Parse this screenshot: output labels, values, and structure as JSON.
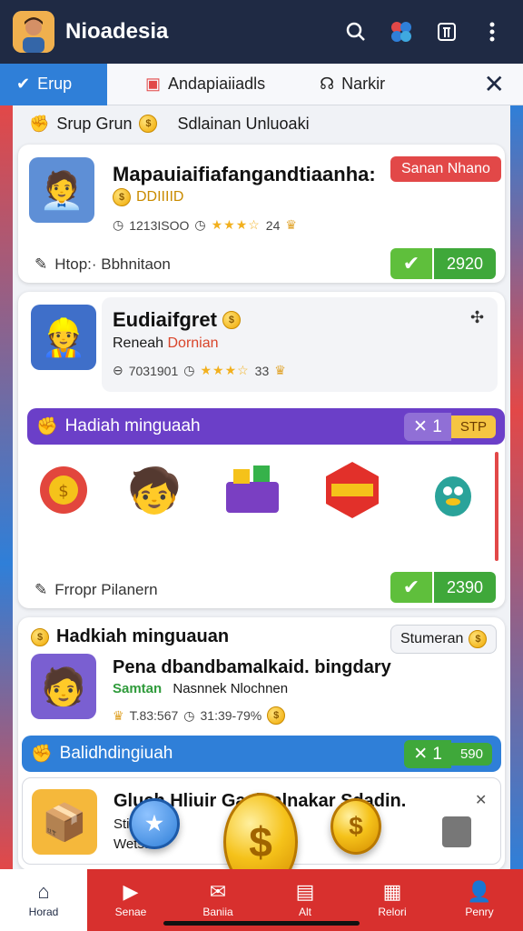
{
  "appbar": {
    "title": "Nioadesia"
  },
  "tabs": {
    "items": [
      {
        "label": "Erup"
      },
      {
        "label": "Andapiaiiadls"
      },
      {
        "label": "Narkir"
      }
    ]
  },
  "section1": {
    "label": "Srup Grun",
    "sub_label": "Sdlainan Unluoaki"
  },
  "card1": {
    "title": "Mapauiaifiafangandtiaanha:",
    "badge": "Sanan Nhano",
    "coin_text": "DDIIIID",
    "meta_time": "1213ISOO",
    "meta_rating": "24",
    "footer": "Htop:· Bbhnitaon",
    "count": "2920"
  },
  "card2": {
    "title": "Eudiaifgret",
    "sub_black": "Reneah",
    "sub_red": "Dornian",
    "meta_time": "7031901",
    "meta_rating": "33"
  },
  "banner1": {
    "label": "Hadiah minguaah",
    "chip_a": "✕ 1",
    "chip_b": "STP"
  },
  "card2_footer": {
    "text": "Frropr Pilanern",
    "count": "2390"
  },
  "section3": {
    "title": "Hadkiah minguauan",
    "pill": "Stumeran"
  },
  "card3": {
    "title": "Pena dbandbamalkaid. bingdary",
    "sub_green": "Samtan",
    "sub_rest": "Nasnnek Nlochnen",
    "meta_time": "T.83:567",
    "meta_rating": "31:39-79%"
  },
  "banner2": {
    "label": "Balidhdingiuah",
    "chip_a": "✕ 1",
    "chip_b": "590"
  },
  "card4": {
    "title": "Gluch Hliuir Gasinalnakar Sdadin.",
    "line2": "Stis",
    "line3": "Wetsa"
  },
  "bottomnav": {
    "items": [
      {
        "label": "Horad"
      },
      {
        "label": "Senae"
      },
      {
        "label": "Baniia"
      },
      {
        "label": "Alt"
      },
      {
        "label": "Relori"
      },
      {
        "label": "Penry"
      }
    ]
  },
  "colors": {
    "primary": "#2f7fd8",
    "accent_red": "#e24848",
    "dark": "#1f2a44",
    "green": "#3fa83a",
    "purple": "#6b3fc8"
  }
}
